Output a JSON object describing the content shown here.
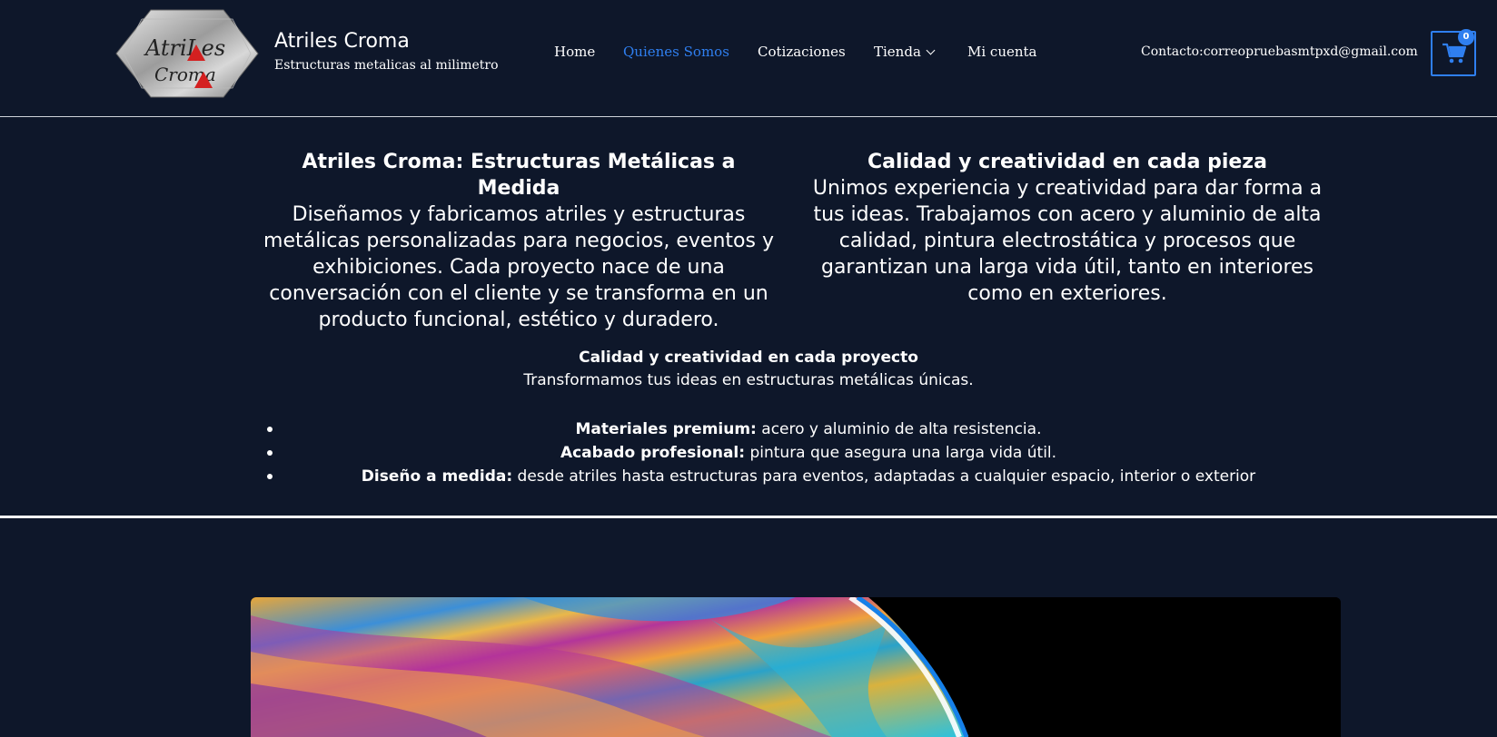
{
  "header": {
    "site_title": "Atriles Croma",
    "tagline": "Estructuras metalicas al milimetro",
    "logo_lines": [
      "AtriLes",
      "Croma"
    ],
    "nav": [
      {
        "label": "Home",
        "active": false
      },
      {
        "label": "Quienes Somos",
        "active": true
      },
      {
        "label": "Cotizaciones",
        "active": false
      },
      {
        "label": "Tienda",
        "active": false,
        "has_dropdown": true
      },
      {
        "label": "Mi cuenta",
        "active": false
      }
    ],
    "contact": "Contacto:correopruebasmtpxd@gmail.com",
    "cart_count": "0",
    "cart_icon": "shopping-cart-icon",
    "accent_color": "#2f7ff0"
  },
  "intro": {
    "left": {
      "title": "Atriles Croma: Estructuras Metálicas a Medida",
      "body": "Diseñamos y fabricamos atriles y estructuras metálicas personalizadas para negocios, eventos y exhibiciones. Cada proyecto nace de una conversación con el cliente y se transforma en un producto funcional, estético y duradero."
    },
    "right": {
      "title": "Calidad y creatividad en cada pieza",
      "body": "Unimos experiencia y creatividad para dar forma a tus ideas. Trabajamos con acero y aluminio de alta calidad, pintura electrostática y procesos que garantizan una larga vida útil, tanto en interiores como en exteriores."
    }
  },
  "quality": {
    "title": "Calidad y creatividad en cada proyecto",
    "subtitle": "Transformamos tus ideas en estructuras metálicas únicas.",
    "features": [
      {
        "label": "Materiales premium:",
        "text": " acero y aluminio de alta resistencia."
      },
      {
        "label": "Acabado profesional:",
        "text": " pintura que asegura una larga vida útil."
      },
      {
        "label": "Diseño a medida:",
        "text": " desde atriles hasta estructuras para eventos, adaptadas a cualquier espacio, interior o exterior"
      }
    ]
  },
  "colors": {
    "background": "#0e172a",
    "text": "#ffffff",
    "link_active": "#2f7ff0"
  }
}
